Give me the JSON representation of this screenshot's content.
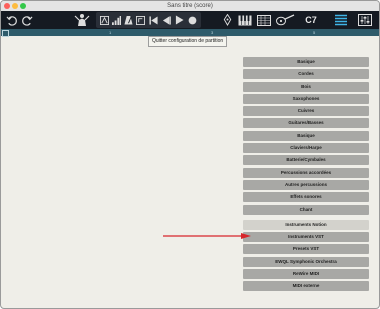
{
  "window": {
    "title": "Sans titre (score)"
  },
  "toolbar": {
    "chord_label": "C7"
  },
  "ruler": {
    "marks": [
      "1",
      "3",
      "5"
    ]
  },
  "tooltip": {
    "text": "Quitter configuration de partition"
  },
  "instrument_menu": {
    "groups": [
      "Basique",
      "Cordes",
      "Bois",
      "Saxophones",
      "Cuivres",
      "Guitares/Basses",
      "Basique",
      "Claviers/Harpe",
      "Batterie/Cymbales",
      "Percussions accordées",
      "Autres percussions",
      "Effets sonores",
      "Chant"
    ],
    "libraries": [
      "Instruments Notion",
      "Instruments VST",
      "Presets VST",
      "EWQL Symphonic Orchestra",
      "ReWire MIDI",
      "MIDI externe"
    ],
    "highlighted": "Instruments Notion"
  },
  "colors": {
    "toolbar": "#151a22",
    "ruler": "#2e5b6a",
    "menu_item": "#a8a8a5",
    "menu_item_selected": "#d3d2cc",
    "arrow": "#d7262b"
  }
}
